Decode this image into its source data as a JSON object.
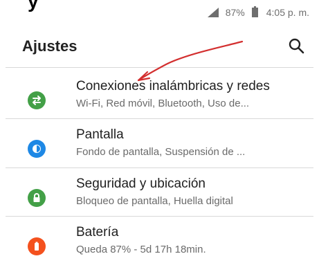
{
  "cut_top_text": "y",
  "status_bar": {
    "battery_percent": "87%",
    "time": "4:05 p. m."
  },
  "header": {
    "title": "Ajustes",
    "search_icon": "search-icon"
  },
  "settings": [
    {
      "icon": "wifi-swap-icon",
      "color": "#43a047",
      "label": "Conexiones inalámbricas y redes",
      "subtitle": "Wi-Fi, Red móvil, Bluetooth, Uso de..."
    },
    {
      "icon": "brightness-icon",
      "color": "#1e88e5",
      "label": "Pantalla",
      "subtitle": "Fondo de pantalla, Suspensión de ..."
    },
    {
      "icon": "lock-icon",
      "color": "#43a047",
      "label": "Seguridad y ubicación",
      "subtitle": "Bloqueo de pantalla, Huella digital"
    },
    {
      "icon": "battery-icon",
      "color": "#f4511e",
      "label": "Batería",
      "subtitle": "Queda 87% - 5d 17h 18min."
    }
  ],
  "annotation_color": "#d32f2f"
}
